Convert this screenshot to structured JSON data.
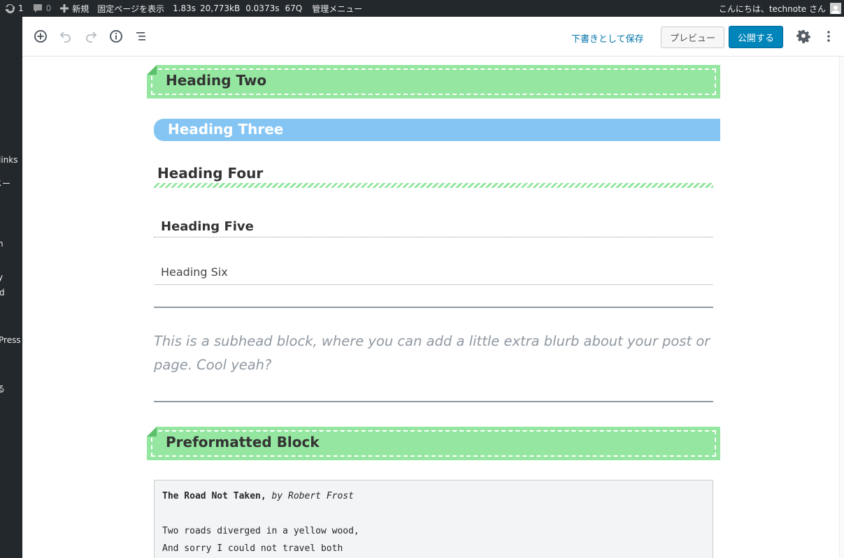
{
  "admin_bar": {
    "updates_count": "1",
    "comments_count": "0",
    "new_label": "新規",
    "view_page_label": "固定ページを表示",
    "perf": [
      "1.83s",
      "20,773kB",
      "0.0373s",
      "67Q"
    ],
    "admin_menu_label": "管理メニュー",
    "greeting": "こんにちは、technote さん"
  },
  "admin_menu": {
    "items": [
      "links",
      "メー",
      "n",
      "y",
      "d",
      "Press",
      "る"
    ]
  },
  "editor_header": {
    "save_draft": "下書きとして保存",
    "preview": "プレビュー",
    "publish": "公開する"
  },
  "blocks": {
    "heading_two": "Heading Two",
    "heading_three": "Heading Three",
    "heading_four": "Heading Four",
    "heading_five": "Heading Five",
    "heading_six": "Heading Six",
    "subhead": "This is a subhead block, where you can add a little extra blurb about your post or page. Cool yeah?",
    "preformatted_heading": "Preformatted Block",
    "pre_title": "The Road Not Taken,",
    "pre_author": "by Robert Frost",
    "pre_line1": "Two roads diverged in a yellow wood,",
    "pre_line2": "And sorry I could not travel both"
  },
  "colors": {
    "admin_bar_bg": "#23282d",
    "primary_button": "#0085ba",
    "link": "#0073aa",
    "heading_two_bg": "#94e6a0",
    "heading_three_bg": "#85c5f3",
    "separator": "#8f98a1"
  }
}
